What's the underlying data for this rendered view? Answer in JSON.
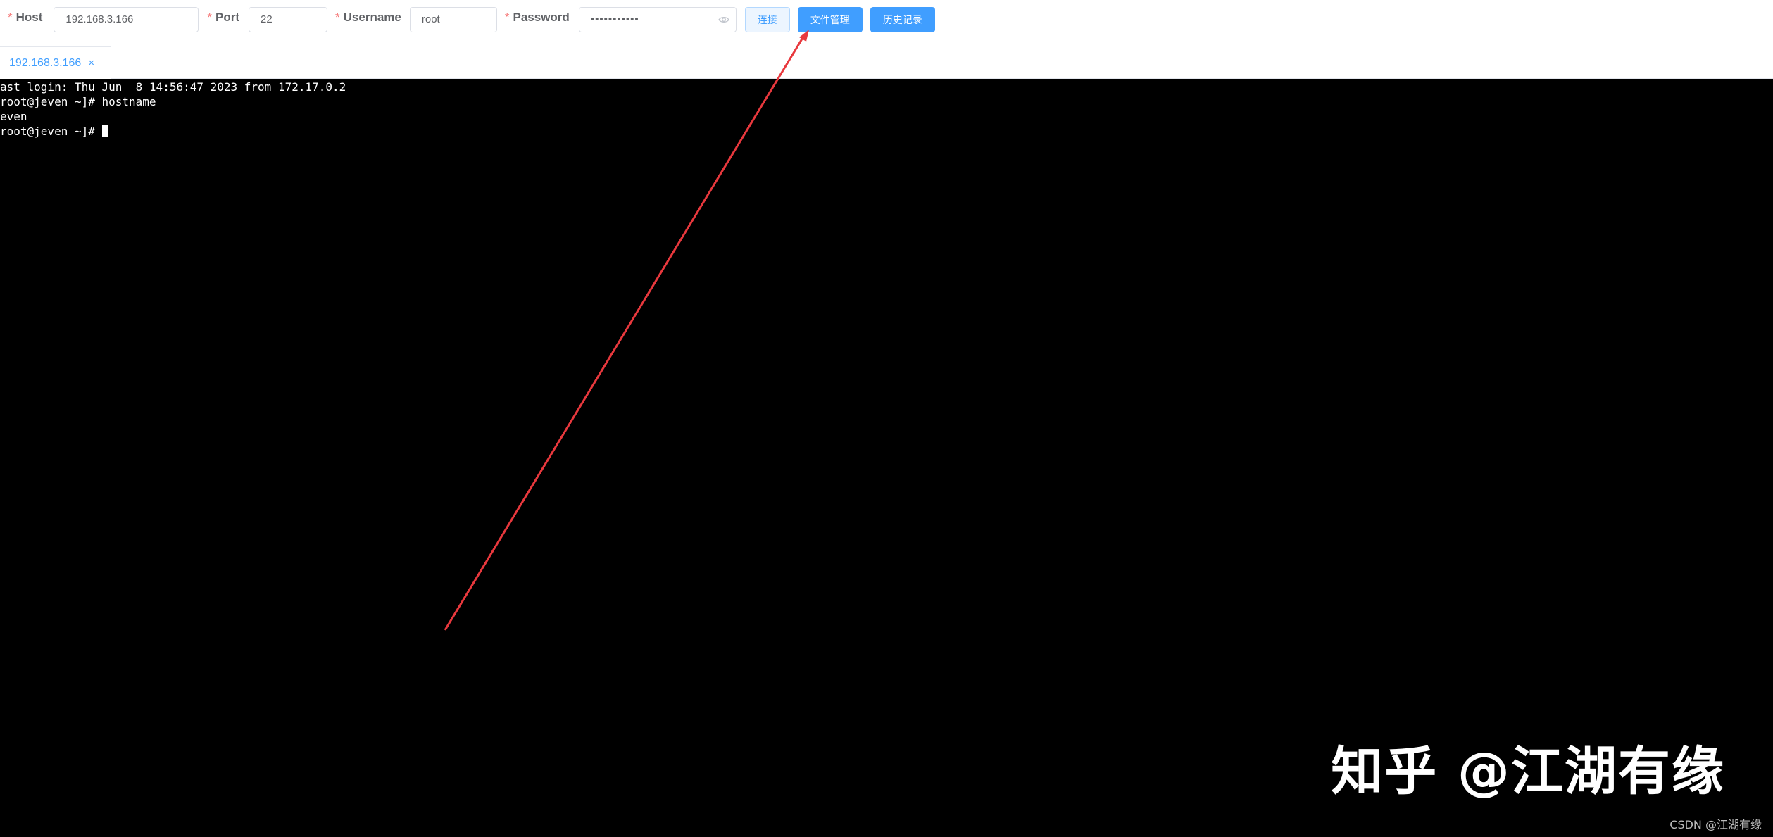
{
  "form": {
    "required_mark": "*",
    "host": {
      "label": "Host",
      "value": "192.168.3.166"
    },
    "port": {
      "label": "Port",
      "value": "22"
    },
    "username": {
      "label": "Username",
      "value": "root"
    },
    "password": {
      "label": "Password",
      "value": "•••••••••••",
      "icon": "eye-icon"
    },
    "buttons": {
      "connect": "连接",
      "file_manage": "文件管理",
      "history": "历史记录"
    }
  },
  "tabs": [
    {
      "label": "192.168.3.166",
      "close_glyph": "×",
      "active": true
    }
  ],
  "terminal": {
    "lines": [
      "ast login: Thu Jun  8 14:56:47 2023 from 172.17.0.2",
      "root@jeven ~]# hostname",
      "even",
      "root@jeven ~]# "
    ],
    "background": "#000000",
    "foreground": "#ffffff"
  },
  "annotation": {
    "color": "#e8383d",
    "shape": "arrow"
  },
  "watermark": {
    "large": "知乎 @江湖有缘",
    "small": "CSDN @江湖有缘"
  },
  "colors": {
    "accent": "#409eff",
    "required": "#f56c6c",
    "label": "#606266"
  }
}
